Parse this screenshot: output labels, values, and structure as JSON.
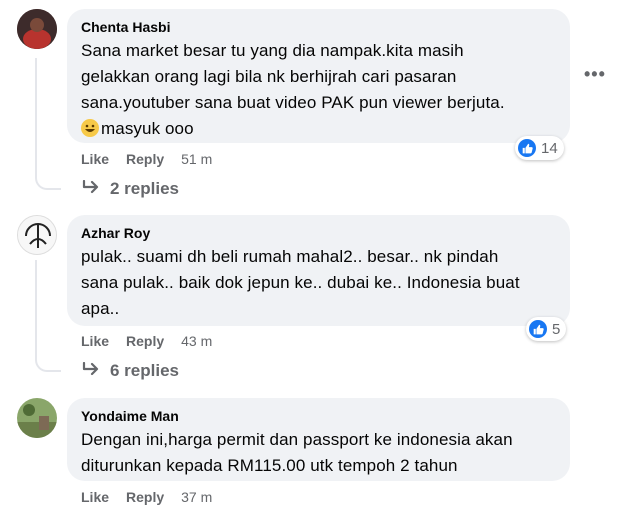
{
  "comments": [
    {
      "author": "Chenta Hasbi",
      "lines": [
        "Sana market besar tu yang dia nampak.kita masih",
        "gelakkan orang lagi bila nk berhijrah cari pasaran",
        "sana.youtuber sana buat video PAK pun viewer berjuta."
      ],
      "last_line": "masyuk ooo",
      "like_label": "Like",
      "reply_label": "Reply",
      "time": "51 m",
      "reaction_count": "14",
      "replies": "2 replies"
    },
    {
      "author": "Azhar Roy",
      "lines": [
        "pulak.. suami dh beli rumah mahal2.. besar.. nk pindah",
        "sana pulak.. baik dok jepun ke.. dubai ke.. Indonesia buat",
        "apa.."
      ],
      "like_label": "Like",
      "reply_label": "Reply",
      "time": "43 m",
      "reaction_count": "5",
      "replies": "6 replies"
    },
    {
      "author": "Yondaime Man",
      "lines": [
        "Dengan ini,harga permit dan passport ke indonesia akan",
        "diturunkan kepada RM115.00 utk tempoh 2 tahun"
      ],
      "like_label": "Like",
      "reply_label": "Reply",
      "time": "37 m"
    }
  ],
  "more_icon": "more-horizontal-icon",
  "accent": "#1877f2"
}
